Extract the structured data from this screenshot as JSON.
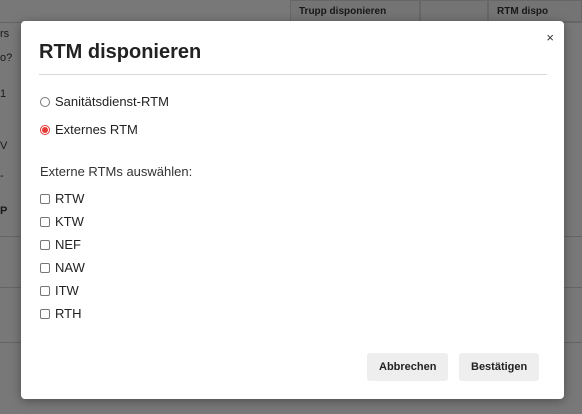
{
  "background": {
    "header_cells": [
      "Trupp disponieren",
      "RTM dispo"
    ],
    "left_fragments": [
      "rs",
      "o?",
      "1",
      "V",
      "-",
      "P"
    ]
  },
  "modal": {
    "title": "RTM disponieren",
    "close_label": "×",
    "radio_options": [
      {
        "label": "Sanitätsdienst-RTM",
        "checked": false
      },
      {
        "label": "Externes RTM",
        "checked": true
      }
    ],
    "external_label": "Externe RTMs auswählen:",
    "checkbox_options": [
      {
        "label": "RTW"
      },
      {
        "label": "KTW"
      },
      {
        "label": "NEF"
      },
      {
        "label": "NAW"
      },
      {
        "label": "ITW"
      },
      {
        "label": "RTH"
      }
    ],
    "cancel_label": "Abbrechen",
    "confirm_label": "Bestätigen"
  },
  "colors": {
    "accent": "#e53935",
    "button_bg": "#eeeeee"
  }
}
